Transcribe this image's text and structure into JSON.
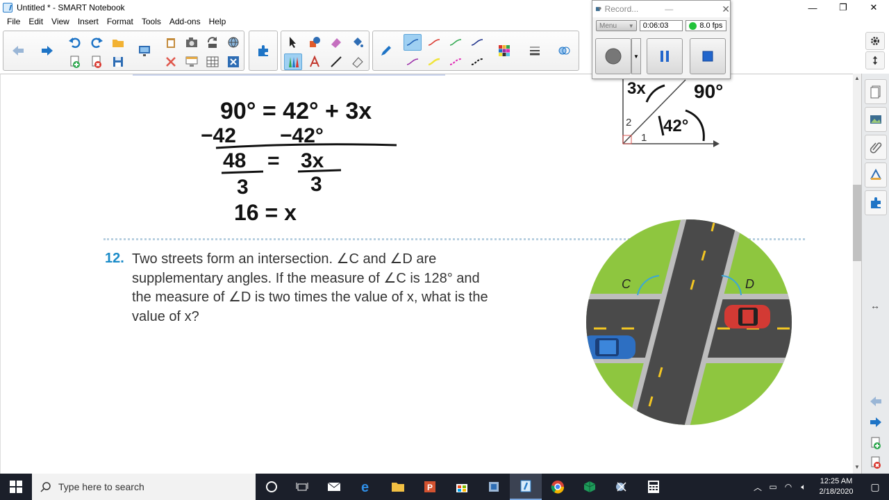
{
  "window": {
    "title": "Untitled * - SMART Notebook",
    "controls": {
      "minimize": "—",
      "restore": "❐",
      "close": "✕"
    }
  },
  "menu": [
    "File",
    "Edit",
    "View",
    "Insert",
    "Format",
    "Tools",
    "Add-ons",
    "Help"
  ],
  "recorder": {
    "title": "Record...",
    "menu_label": "Menu",
    "elapsed": "0:06:03",
    "fps": "8.0 fps"
  },
  "handwriting": {
    "line1": "90° = 42° + 3x",
    "line2_left": "−42",
    "line2_right": "−42°",
    "frac_left_num": "48",
    "frac_equals": "=",
    "frac_right_num": "3x",
    "frac_left_den": "3",
    "frac_right_den": "3",
    "result": "16 = x"
  },
  "diagram": {
    "label_3x": "3x",
    "label_90": "90°",
    "label_42": "42°",
    "label_2": "2",
    "label_1": "1"
  },
  "problem": {
    "number": "12.",
    "text": "Two streets form an intersection. ∠C and ∠D are supplementary angles. If the measure of ∠C is 128° and the measure of ∠D is two times the value of x, what is the value of x?"
  },
  "intersection": {
    "label_c": "C",
    "label_d": "D"
  },
  "taskbar": {
    "search_placeholder": "Type here to search",
    "time": "12:25 AM",
    "date": "2/18/2020"
  },
  "colors": {
    "accent_blue": "#1a8bc8",
    "grass": "#8ec63f",
    "road": "#4a4a4a",
    "taskbar": "#1b1f2a"
  }
}
